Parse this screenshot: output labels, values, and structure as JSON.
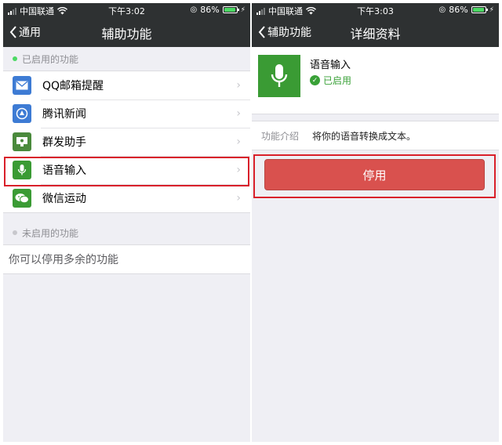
{
  "left": {
    "status": {
      "carrier": "中国联通",
      "time": "下午3:02",
      "battery": "86%",
      "battery_level": 0.86
    },
    "nav": {
      "back_label": "通用",
      "title": "辅助功能"
    },
    "enabled_header": "已启用的功能",
    "enabled_items": [
      {
        "label": "QQ邮箱提醒",
        "icon": "mail-icon",
        "color": "#3d7bd4"
      },
      {
        "label": "腾讯新闻",
        "icon": "news-icon",
        "color": "#3d7bd4"
      },
      {
        "label": "群发助手",
        "icon": "broadcast-icon",
        "color": "#4a8a3c"
      },
      {
        "label": "语音输入",
        "icon": "microphone-icon",
        "color": "#3a9b34"
      },
      {
        "label": "微信运动",
        "icon": "wechat-sport-icon",
        "color": "#3a9b34"
      }
    ],
    "disabled_header": "未启用的功能",
    "disabled_hint": "你可以停用多余的功能"
  },
  "right": {
    "status": {
      "carrier": "中国联通",
      "time": "下午3:03",
      "battery": "86%",
      "battery_level": 0.86
    },
    "nav": {
      "back_label": "辅助功能",
      "title": "详细资料"
    },
    "profile": {
      "name": "语音输入",
      "status": "已启用"
    },
    "intro": {
      "key": "功能介绍",
      "value": "将你的语音转换成文本。"
    },
    "button_label": "停用",
    "accent": "#d9514e"
  }
}
